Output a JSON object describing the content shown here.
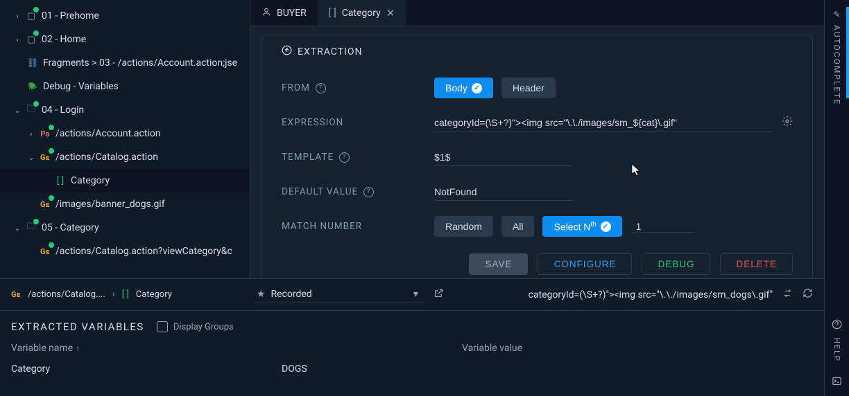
{
  "tree": {
    "n01": "01 - Prehome",
    "n02": "02 - Home",
    "frag": "Fragments > 03 - /actions/Account.action;jse",
    "debug": "Debug - Variables",
    "n04": "04 - Login",
    "acct": "/actions/Account.action",
    "cat": "/actions/Catalog.action",
    "category": "Category",
    "banner": "/images/banner_dogs.gif",
    "n05": "05 - Category",
    "catview": "/actions/Catalog.action?viewCategory&c"
  },
  "tabs": {
    "buyer": "BUYER",
    "cat": "Category"
  },
  "ext": {
    "title": "EXTRACTION",
    "from": "FROM",
    "body": "Body",
    "header": "Header",
    "expr_lbl": "EXPRESSION",
    "expr_val": "categoryId=(\\S+?)\"><img src=\"\\.\\./images/sm_${cat}\\.gif\"",
    "tmpl_lbl": "TEMPLATE",
    "tmpl_val": "$1$",
    "def_lbl": "DEFAULT VALUE",
    "def_val": "NotFound",
    "match_lbl": "MATCH NUMBER",
    "random": "Random",
    "all": "All",
    "selectnth": "Select N",
    "nth_val": "1",
    "save": "SAVE",
    "configure": "CONFIGURE",
    "debug": "DEBUG",
    "delete": "DELETE"
  },
  "bottom": {
    "crumb_path": "/actions/Catalog....",
    "crumb_cat": "Category",
    "recorded": "Recorded",
    "match_preview": "categoryId=(\\S+?)\"><img src=\"\\.\\./images/sm_dogs\\.gif\"",
    "title": "EXTRACTED VARIABLES",
    "display_groups": "Display Groups",
    "col_name": "Variable name",
    "col_val": "Variable value",
    "row_name": "Category",
    "row_val": "DOGS"
  },
  "rail": {
    "autocomplete": "AUTOCOMPLETE",
    "help": "HELP"
  }
}
